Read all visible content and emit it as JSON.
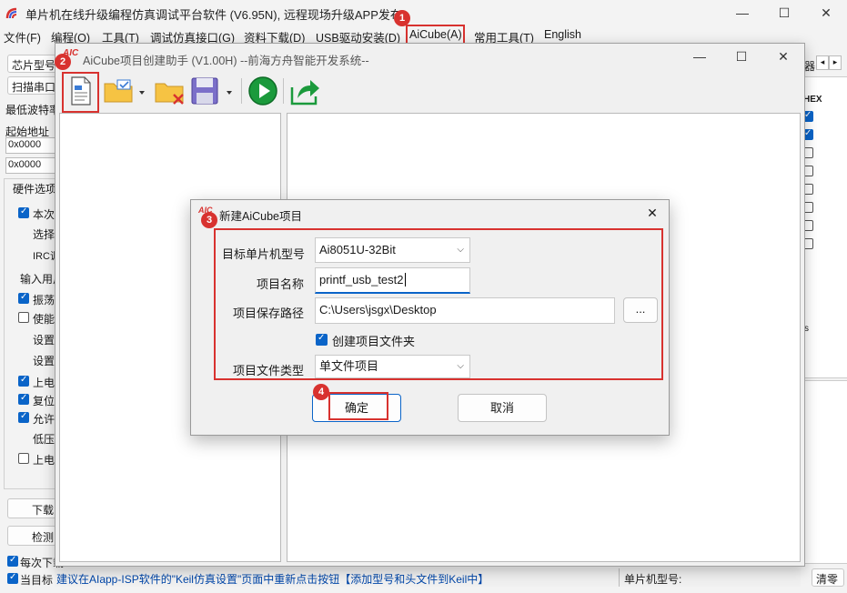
{
  "app": {
    "title": "单片机在线升级编程仿真调试平台软件 (V6.95N), 远程现场升级APP发布",
    "minimize": "—",
    "maximize": "☐",
    "close": "✕"
  },
  "menu": {
    "items": [
      "文件(F)",
      "编程(O)",
      "工具(T)",
      "调试仿真接口(G)",
      "资料下载(D)",
      "USB驱动安装(D)",
      "AiCube(A)",
      "常用工具(T)",
      "English"
    ]
  },
  "left_panel": {
    "chip_model_label": "芯片型号",
    "scan_port_button": "扫描串口",
    "min_baud_label": "最低波特率",
    "start_addr_label": "起始地址",
    "addr1": "0x0000",
    "addr2": "0x0000",
    "hw_options_label": "硬件选项",
    "opt_current": "本次",
    "opt_select": "选择",
    "opt_irc": "IRC调",
    "opt_input": "输入用户",
    "opt_osc": "振荡",
    "opt_enable": "使能",
    "opt_set1": "设置",
    "opt_set2": "设置",
    "opt_poweron": "上电",
    "opt_reset": "复位",
    "opt_allow": "允许",
    "opt_lowv": "低压",
    "opt_poweron2": "上电",
    "download_button": "下载",
    "detect_button": "检测",
    "each_download": "每次下载",
    "current_target": "当目标"
  },
  "right_panel": {
    "tab_label": "器",
    "hex_label": "HEX",
    "s_label": "s",
    "clear_button": "清零"
  },
  "status": {
    "hint": "建议在AIapp-ISP软件的\"Keil仿真设置\"页面中重新点击按钮【添加型号和头文件到Keil中】",
    "mcu_model_label": "单片机型号:"
  },
  "helper": {
    "title": "AiCube项目创建助手 (V1.00H) --前海方舟智能开发系统--",
    "logo": "AIC",
    "toolbar": [
      "new-project-icon",
      "open-folder-icon",
      "delete-folder-icon",
      "save-icon",
      "run-icon",
      "export-icon"
    ]
  },
  "dialog": {
    "title": "新建AiCube项目",
    "logo": "AIC",
    "target_mcu_label": "目标单片机型号",
    "target_mcu_value": "Ai8051U-32Bit",
    "project_name_label": "项目名称",
    "project_name_value": "printf_usb_test2",
    "save_path_label": "项目保存路径",
    "save_path_value": "C:\\Users\\jsgx\\Desktop",
    "browse_button": "...",
    "create_folder_label": "创建项目文件夹",
    "create_folder_checked": true,
    "file_type_label": "项目文件类型",
    "file_type_value": "单文件项目",
    "ok_button": "确定",
    "cancel_button": "取消"
  },
  "annotations": {
    "badge1": "1",
    "badge2": "2",
    "badge3": "3",
    "badge4": "4",
    "color": "#d8322f"
  }
}
